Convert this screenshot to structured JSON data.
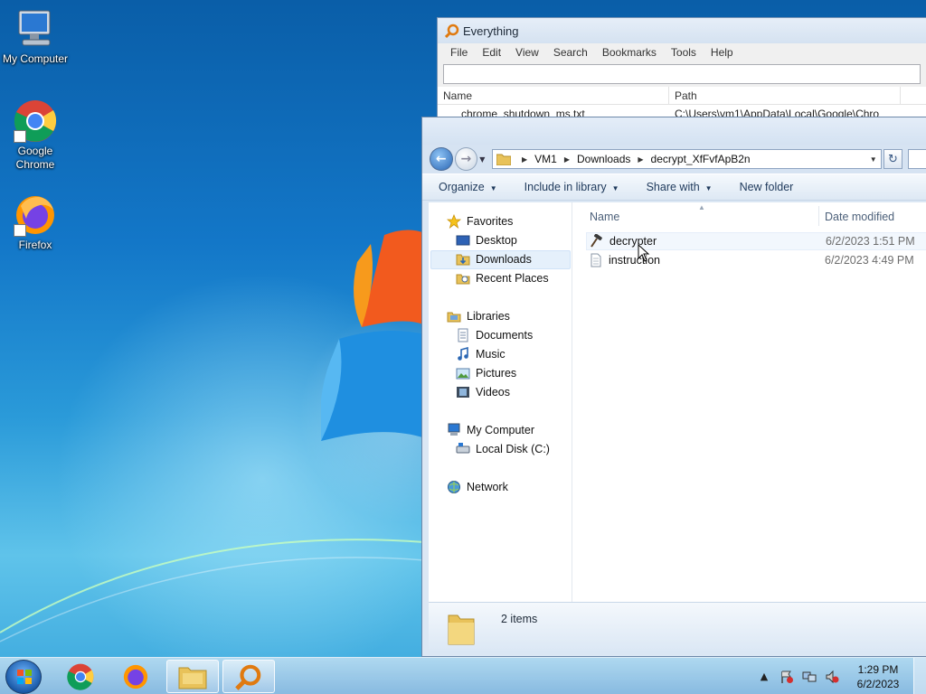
{
  "desktop": {
    "icons": [
      {
        "label": "My Computer",
        "icon": "computer-icon"
      },
      {
        "label": "Google Chrome",
        "icon": "chrome-icon"
      },
      {
        "label": "Firefox",
        "icon": "firefox-icon"
      }
    ]
  },
  "everything": {
    "title": "Everything",
    "menu": [
      "File",
      "Edit",
      "View",
      "Search",
      "Bookmarks",
      "Tools",
      "Help"
    ],
    "search_value": "",
    "columns": [
      "Name",
      "Path"
    ],
    "row": {
      "name": "chrome_shutdown_ms.txt",
      "path": "C:\\Users\\vm1\\AppData\\Local\\Google\\Chro"
    }
  },
  "explorer": {
    "breadcrumb": [
      "VM1",
      "Downloads",
      "decrypt_XfFvfApB2n"
    ],
    "toolbar": {
      "organize": "Organize",
      "include": "Include in library",
      "share": "Share with",
      "new_folder": "New folder"
    },
    "nav": {
      "favorites": "Favorites",
      "desktop": "Desktop",
      "downloads": "Downloads",
      "recent": "Recent Places",
      "libraries": "Libraries",
      "documents": "Documents",
      "music": "Music",
      "pictures": "Pictures",
      "videos": "Videos",
      "computer": "My Computer",
      "local_disk": "Local Disk (C:)",
      "network": "Network"
    },
    "columns": {
      "name": "Name",
      "date": "Date modified"
    },
    "files": [
      {
        "name": "decrypter",
        "date": "6/2/2023 1:51 PM",
        "icon": "executable-icon"
      },
      {
        "name": "instruction",
        "date": "6/2/2023 4:49 PM",
        "icon": "text-file-icon"
      }
    ],
    "status": "2 items"
  },
  "taskbar": {
    "time": "1:29 PM",
    "date": "6/2/2023"
  },
  "colors": {
    "accent": "#2b67b4",
    "selection": "#e5f0fb"
  }
}
